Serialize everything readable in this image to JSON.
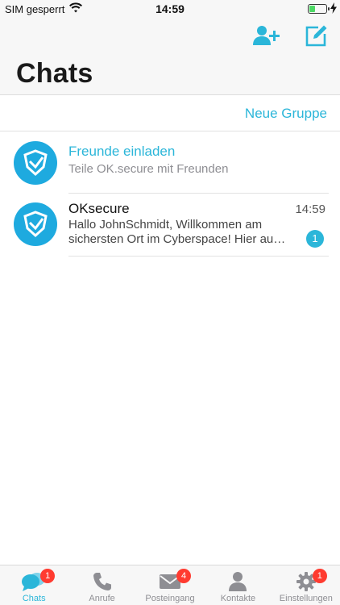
{
  "status_bar": {
    "carrier": "SIM gesperrt",
    "time": "14:59",
    "battery_level": 0.35,
    "icons": [
      "wifi-icon",
      "battery-icon",
      "charging-bolt-icon"
    ]
  },
  "header": {
    "title": "Chats",
    "icons": [
      "add-contact-icon",
      "compose-icon"
    ]
  },
  "group_action": {
    "label": "Neue Gruppe"
  },
  "invite": {
    "title": "Freunde einladen",
    "subtitle": "Teile OK.secure mit Freunden"
  },
  "chats": [
    {
      "name": "OKsecure",
      "time": "14:59",
      "preview_line1": "Hallo JohnSchmidt,  Willkommen am",
      "preview_line2": "sichersten Ort im Cyberspace! Hier au…",
      "unread": "1"
    }
  ],
  "tabs": [
    {
      "label": "Chats",
      "icon": "chat-bubbles-icon",
      "badge": "1",
      "active": true
    },
    {
      "label": "Anrufe",
      "icon": "phone-icon",
      "badge": "",
      "active": false
    },
    {
      "label": "Posteingang",
      "icon": "envelope-icon",
      "badge": "4",
      "active": false
    },
    {
      "label": "Kontakte",
      "icon": "person-icon",
      "badge": "",
      "active": false
    },
    {
      "label": "Einstellungen",
      "icon": "gear-icon",
      "badge": "1",
      "active": false
    }
  ],
  "colors": {
    "accent": "#2bb6d9",
    "avatar": "#1eaadf",
    "badge_red": "#ff3b30",
    "battery_green": "#4cd964",
    "inactive_tab": "#8e8e93"
  }
}
